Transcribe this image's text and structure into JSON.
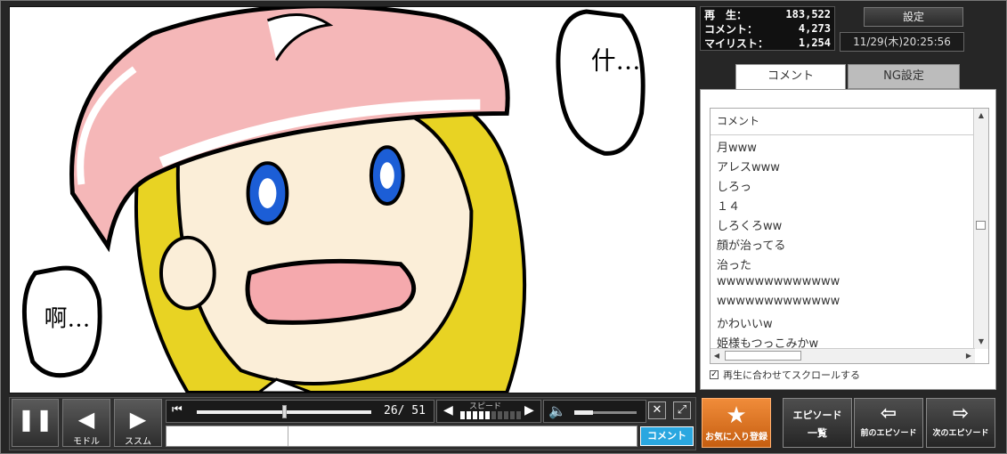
{
  "stats": {
    "views_label": "再　生：",
    "views": "183,522",
    "comments_label": "コメント：",
    "comments": "4,273",
    "mylist_label": "マイリスト：",
    "mylist": "1,254"
  },
  "settings_label": "設定",
  "datetime": "11/29(木)20:25:56",
  "tabs": {
    "comment": "コメント",
    "ng": "NG設定"
  },
  "comment_list": {
    "header": "コメント",
    "items": [
      "月www",
      "アレスwww",
      "しろっ",
      "１４",
      "しろくろww",
      "顔が治ってる",
      "治った",
      "wwwwwwwwwwwww",
      "wwwwwwwwwwwww",
      "かわいいw",
      "姫様もつっこみかw"
    ]
  },
  "sync_scroll_label": "再生に合わせてスクロールする",
  "player": {
    "back_label": "モドル",
    "forward_label": "ススム",
    "time_text": "26/ 51",
    "speed_label": "スピード",
    "speed_level": 5,
    "speed_max": 10,
    "seek_position": 0.5,
    "volume_level": 0.3,
    "comment_submit": "コメント"
  },
  "buttons": {
    "favorite": "お気に入り登録",
    "episode_list_line1": "エピソード",
    "episode_list_line2": "一覧",
    "prev_episode": "前のエピソード",
    "next_episode": "次のエピソード"
  },
  "speech": {
    "right": "什…",
    "left": "啊…"
  }
}
